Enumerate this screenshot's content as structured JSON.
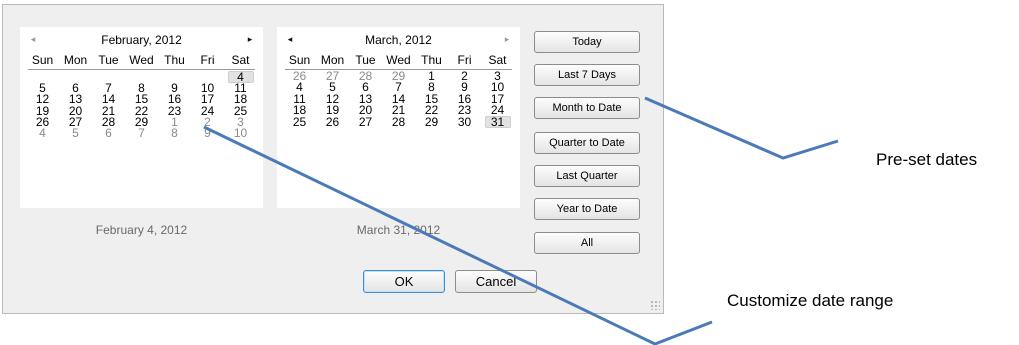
{
  "left_calendar": {
    "title": "February, 2012",
    "prev_icon": "◂",
    "next_icon": "▸",
    "weekdays": [
      "Sun",
      "Mon",
      "Tue",
      "Wed",
      "Thu",
      "Fri",
      "Sat"
    ],
    "weeks": [
      [
        {
          "d": "",
          "t": "blank"
        },
        {
          "d": "",
          "t": "blank"
        },
        {
          "d": "",
          "t": "blank"
        },
        {
          "d": "",
          "t": "blank"
        },
        {
          "d": "",
          "t": "blank"
        },
        {
          "d": "",
          "t": "blank"
        },
        {
          "d": "4",
          "t": "sel"
        }
      ],
      [
        {
          "d": "5",
          "t": "cur"
        },
        {
          "d": "6",
          "t": "cur"
        },
        {
          "d": "7",
          "t": "cur"
        },
        {
          "d": "8",
          "t": "cur"
        },
        {
          "d": "9",
          "t": "cur"
        },
        {
          "d": "10",
          "t": "cur"
        },
        {
          "d": "11",
          "t": "cur"
        }
      ],
      [
        {
          "d": "12",
          "t": "cur"
        },
        {
          "d": "13",
          "t": "cur"
        },
        {
          "d": "14",
          "t": "cur"
        },
        {
          "d": "15",
          "t": "cur"
        },
        {
          "d": "16",
          "t": "cur"
        },
        {
          "d": "17",
          "t": "cur"
        },
        {
          "d": "18",
          "t": "cur"
        }
      ],
      [
        {
          "d": "19",
          "t": "cur"
        },
        {
          "d": "20",
          "t": "cur"
        },
        {
          "d": "21",
          "t": "cur"
        },
        {
          "d": "22",
          "t": "cur"
        },
        {
          "d": "23",
          "t": "cur"
        },
        {
          "d": "24",
          "t": "cur"
        },
        {
          "d": "25",
          "t": "cur"
        }
      ],
      [
        {
          "d": "26",
          "t": "cur"
        },
        {
          "d": "27",
          "t": "cur"
        },
        {
          "d": "28",
          "t": "cur"
        },
        {
          "d": "29",
          "t": "cur"
        },
        {
          "d": "1",
          "t": "other"
        },
        {
          "d": "2",
          "t": "other"
        },
        {
          "d": "3",
          "t": "other"
        }
      ],
      [
        {
          "d": "4",
          "t": "other"
        },
        {
          "d": "5",
          "t": "other"
        },
        {
          "d": "6",
          "t": "other"
        },
        {
          "d": "7",
          "t": "other"
        },
        {
          "d": "8",
          "t": "other"
        },
        {
          "d": "9",
          "t": "other"
        },
        {
          "d": "10",
          "t": "other"
        }
      ]
    ],
    "selected_date_text": "February 4, 2012"
  },
  "right_calendar": {
    "title": "March, 2012",
    "prev_icon": "◂",
    "next_icon": "▸",
    "weekdays": [
      "Sun",
      "Mon",
      "Tue",
      "Wed",
      "Thu",
      "Fri",
      "Sat"
    ],
    "weeks": [
      [
        {
          "d": "26",
          "t": "other"
        },
        {
          "d": "27",
          "t": "other"
        },
        {
          "d": "28",
          "t": "other"
        },
        {
          "d": "29",
          "t": "other"
        },
        {
          "d": "1",
          "t": "cur"
        },
        {
          "d": "2",
          "t": "cur"
        },
        {
          "d": "3",
          "t": "cur"
        }
      ],
      [
        {
          "d": "4",
          "t": "cur"
        },
        {
          "d": "5",
          "t": "cur"
        },
        {
          "d": "6",
          "t": "cur"
        },
        {
          "d": "7",
          "t": "cur"
        },
        {
          "d": "8",
          "t": "cur"
        },
        {
          "d": "9",
          "t": "cur"
        },
        {
          "d": "10",
          "t": "cur"
        }
      ],
      [
        {
          "d": "11",
          "t": "cur"
        },
        {
          "d": "12",
          "t": "cur"
        },
        {
          "d": "13",
          "t": "cur"
        },
        {
          "d": "14",
          "t": "cur"
        },
        {
          "d": "15",
          "t": "cur"
        },
        {
          "d": "16",
          "t": "cur"
        },
        {
          "d": "17",
          "t": "cur"
        }
      ],
      [
        {
          "d": "18",
          "t": "cur"
        },
        {
          "d": "19",
          "t": "cur"
        },
        {
          "d": "20",
          "t": "cur"
        },
        {
          "d": "21",
          "t": "cur"
        },
        {
          "d": "22",
          "t": "cur"
        },
        {
          "d": "23",
          "t": "cur"
        },
        {
          "d": "24",
          "t": "cur"
        }
      ],
      [
        {
          "d": "25",
          "t": "cur"
        },
        {
          "d": "26",
          "t": "cur"
        },
        {
          "d": "27",
          "t": "cur"
        },
        {
          "d": "28",
          "t": "cur"
        },
        {
          "d": "29",
          "t": "cur"
        },
        {
          "d": "30",
          "t": "cur"
        },
        {
          "d": "31",
          "t": "sel"
        }
      ],
      [
        {
          "d": "",
          "t": "blank"
        },
        {
          "d": "",
          "t": "blank"
        },
        {
          "d": "",
          "t": "blank"
        },
        {
          "d": "",
          "t": "blank"
        },
        {
          "d": "",
          "t": "blank"
        },
        {
          "d": "",
          "t": "blank"
        },
        {
          "d": "",
          "t": "blank"
        }
      ]
    ],
    "selected_date_text": "March 31, 2012"
  },
  "presets": {
    "today": "Today",
    "last7": "Last 7 Days",
    "month_to_date": "Month to Date",
    "quarter_to_date": "Quarter to Date",
    "last_quarter": "Last Quarter",
    "year_to_date": "Year to Date",
    "all": "All"
  },
  "actions": {
    "ok": "OK",
    "cancel": "Cancel"
  },
  "annotations": {
    "preset_label": "Pre-set dates",
    "custom_label": "Customize date range",
    "line_color": "#4a7ab8"
  }
}
